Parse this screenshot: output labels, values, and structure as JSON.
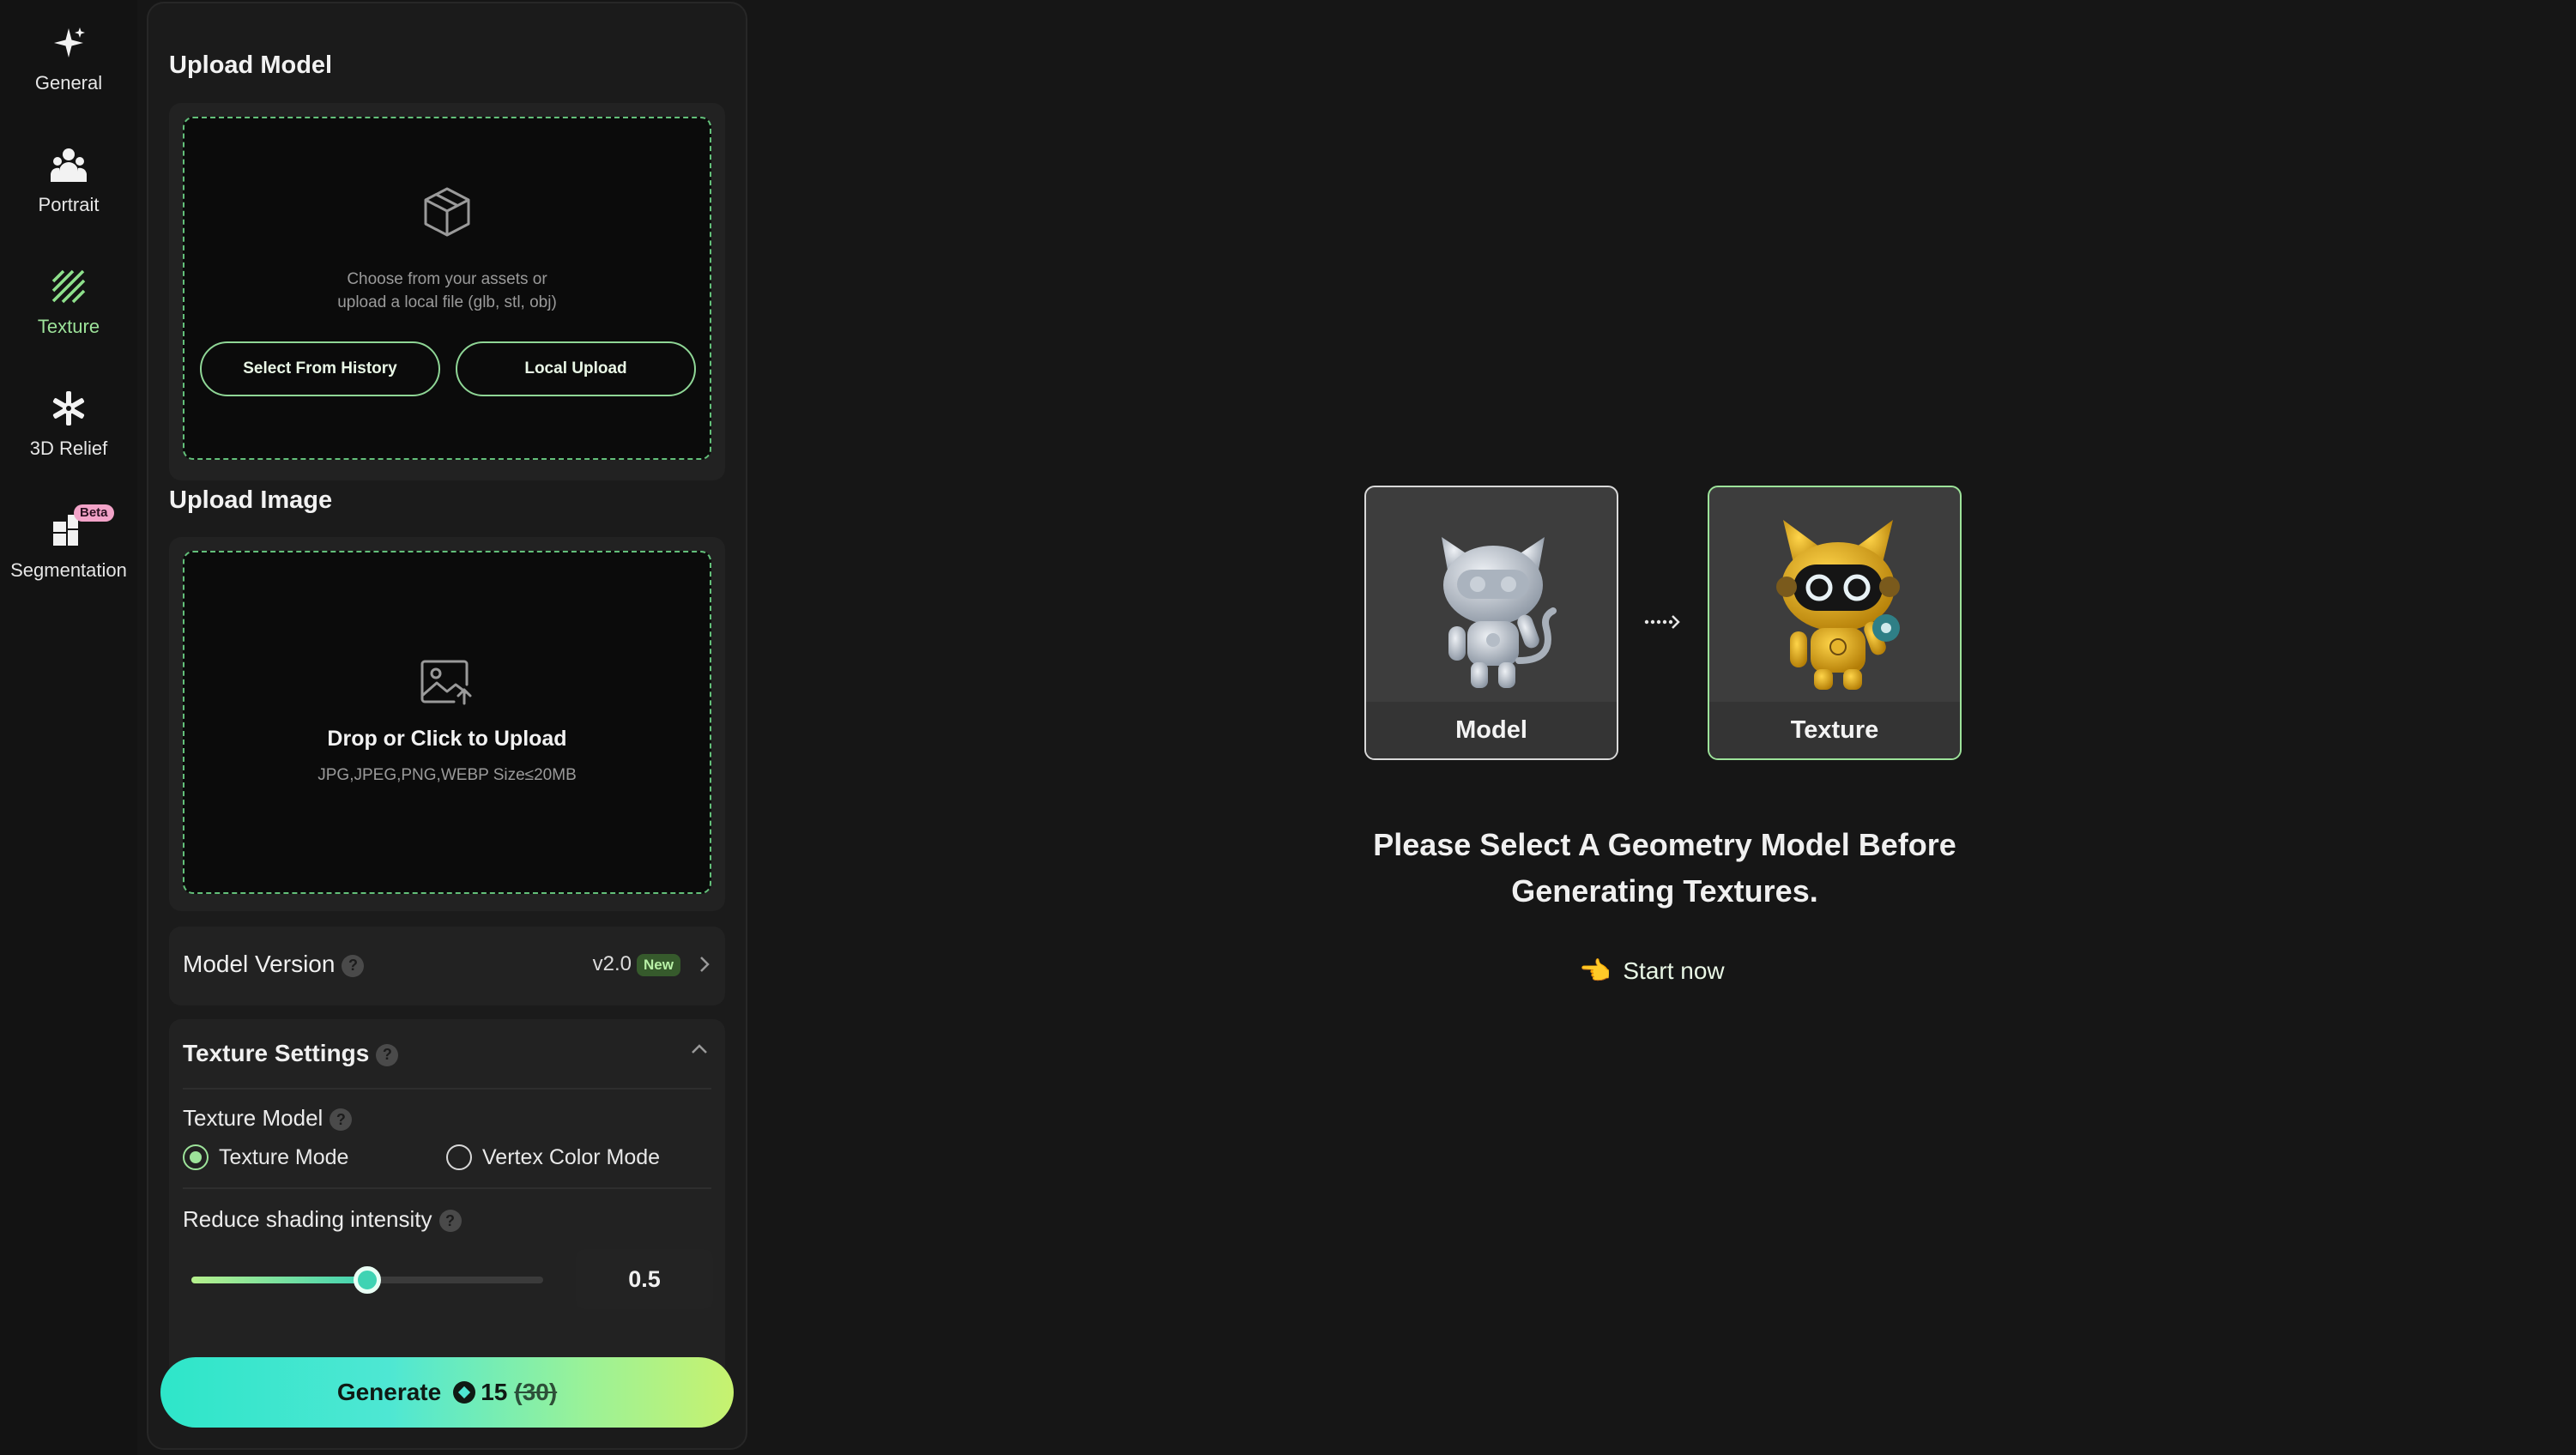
{
  "rail": {
    "items": [
      {
        "label": "General",
        "icon": "sparkle-icon"
      },
      {
        "label": "Portrait",
        "icon": "people-icon"
      },
      {
        "label": "Texture",
        "icon": "texture-icon",
        "active": true
      },
      {
        "label": "3D Relief",
        "icon": "relief-icon"
      },
      {
        "label": "Segmentation",
        "icon": "segmentation-icon",
        "badge": "Beta"
      }
    ]
  },
  "upload_model": {
    "title": "Upload Model",
    "description": "Choose from your assets or\nupload a local file (glb, stl, obj)",
    "select_history_label": "Select From History",
    "local_upload_label": "Local Upload"
  },
  "upload_image": {
    "title": "Upload Image",
    "drop_label": "Drop or Click to Upload",
    "formats": "JPG,JPEG,PNG,WEBP Size≤20MB"
  },
  "model_version": {
    "label": "Model Version",
    "value": "v2.0",
    "badge": "New"
  },
  "texture_settings": {
    "title": "Texture Settings",
    "texture_model_label": "Texture Model",
    "options": [
      "Texture Mode",
      "Vertex Color Mode"
    ],
    "selected": "Texture Mode",
    "shading_label": "Reduce shading intensity",
    "shading_value": "0.5",
    "shading_fraction": 0.5
  },
  "generate": {
    "label": "Generate",
    "cost": "15",
    "original_cost": "(30)"
  },
  "main": {
    "model_caption": "Model",
    "texture_caption": "Texture",
    "message": "Please Select A Geometry Model Before\nGenerating Textures.",
    "start_label": "Start now",
    "start_emoji": "👈"
  },
  "colors": {
    "accent": "#9de39a",
    "generate_gradient_start": "#2ee6c9",
    "generate_gradient_end": "#c7f26f",
    "background": "#161616"
  }
}
